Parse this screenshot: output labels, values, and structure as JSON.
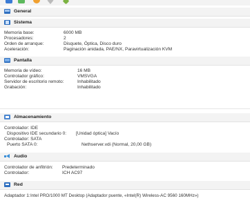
{
  "general": {
    "title": "General"
  },
  "system": {
    "title": "Sistema",
    "rows": [
      {
        "label": "Memoria base:",
        "value": "6000 MB"
      },
      {
        "label": "Procesadores:",
        "value": "2"
      },
      {
        "label": "Orden de arranque:",
        "value": "Disquete, Óptica, Disco duro"
      },
      {
        "label": "Aceleración:",
        "value": "Paginación anidada, PAE/NX, Paravirtualización KVM"
      }
    ]
  },
  "display": {
    "title": "Pantalla",
    "rows": [
      {
        "label": "Memoria de vídeo:",
        "value": "16 MB"
      },
      {
        "label": "Controlador gráfico:",
        "value": "VMSVGA"
      },
      {
        "label": "Servidor de escritorio remoto:",
        "value": "Inhabilitado"
      },
      {
        "label": "Grabación:",
        "value": "Inhabilitado"
      }
    ]
  },
  "storage": {
    "title": "Almacenamiento",
    "rows": [
      {
        "label": "Controlador: IDE",
        "value": ""
      },
      {
        "label": "  Dispositivo IDE secundario 0:",
        "value": "[Unidad óptica] Vacío"
      },
      {
        "label": "Controlador: SATA",
        "value": ""
      },
      {
        "label": "  Puerto SATA 0:",
        "value": "Nethserver.vdi (Normal, 20,00 GB)"
      }
    ]
  },
  "audio": {
    "title": "Audio",
    "rows": [
      {
        "label": "Controlador de anfitrión:",
        "value": "Predeterminado"
      },
      {
        "label": "Controlador:",
        "value": "ICH AC97"
      }
    ]
  },
  "network": {
    "title": "Red",
    "rows": [
      {
        "label": "Adaptador 1:",
        "value": "Intel PRO/1000 MT Desktop (Adaptador puente, «Intel(R) Wireless-AC 9560 160MHz»)"
      }
    ]
  }
}
